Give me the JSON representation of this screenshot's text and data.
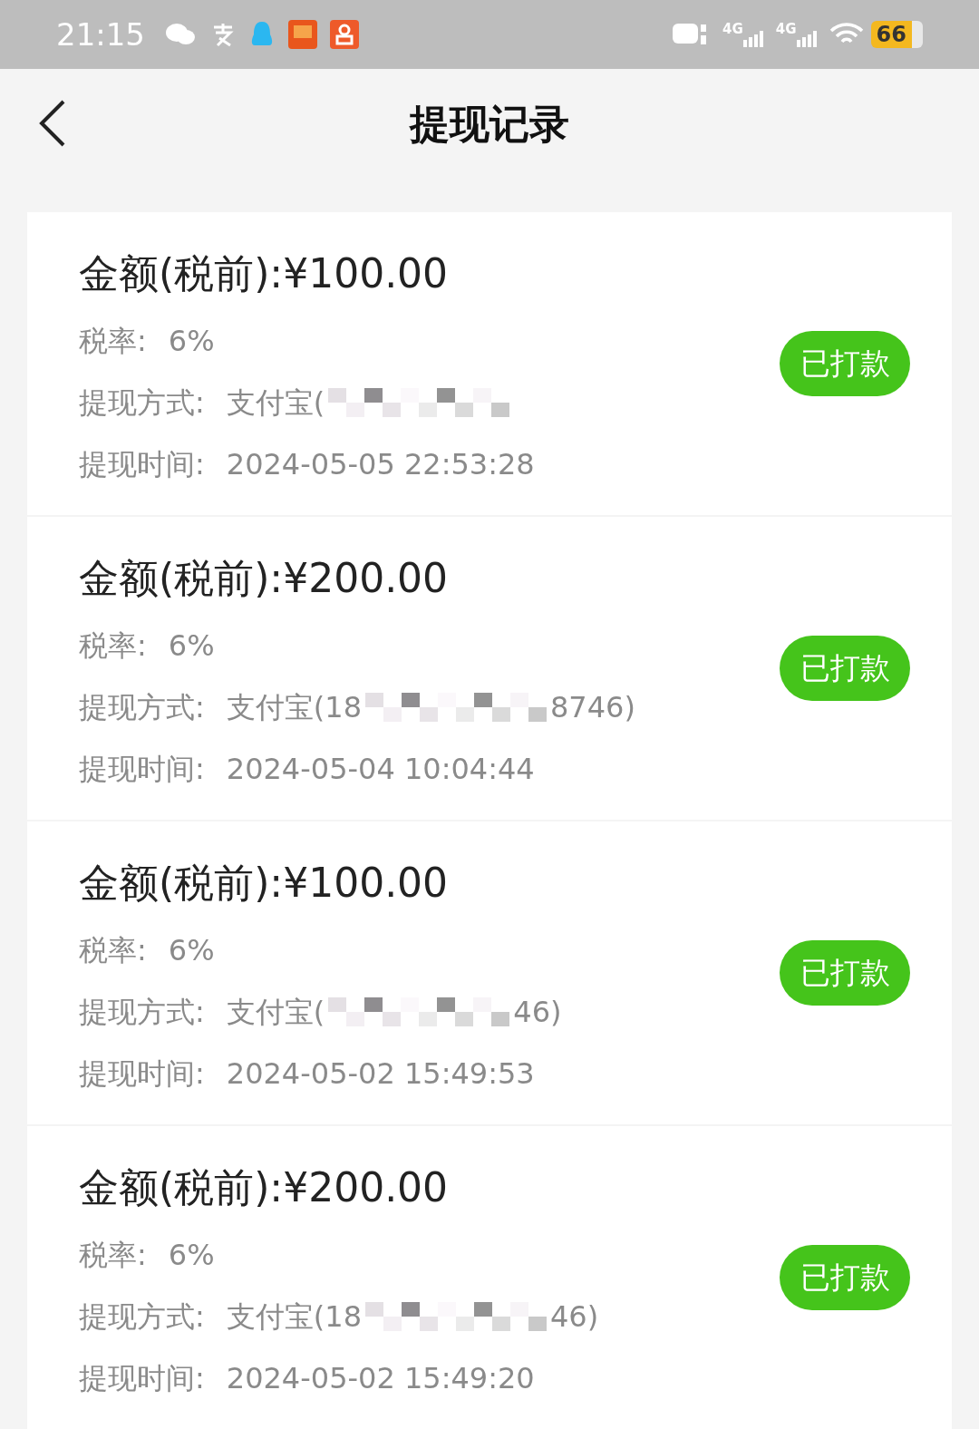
{
  "status_bar": {
    "time": "21:15",
    "network_labels": [
      "4G",
      "4G"
    ],
    "battery": "66"
  },
  "header": {
    "title": "提现记录"
  },
  "records": [
    {
      "amount_label": "金额(税前):",
      "amount": "¥100.00",
      "tax_label": "税率:",
      "tax": "6%",
      "method_label": "提现方式:",
      "method_prefix": "支付宝(",
      "time_label": "提现时间:",
      "time": "2024-05-05 22:53:28",
      "status": "已打款"
    },
    {
      "amount_label": "金额(税前):",
      "amount": "¥200.00",
      "tax_label": "税率:",
      "tax": "6%",
      "method_label": "提现方式:",
      "method_prefix": "支付宝(18",
      "method_suffix": "8746)",
      "time_label": "提现时间:",
      "time": "2024-05-04 10:04:44",
      "status": "已打款"
    },
    {
      "amount_label": "金额(税前):",
      "amount": "¥100.00",
      "tax_label": "税率:",
      "tax": "6%",
      "method_label": "提现方式:",
      "method_prefix": "支付宝(",
      "method_suffix": "46)",
      "time_label": "提现时间:",
      "time": "2024-05-02 15:49:53",
      "status": "已打款"
    },
    {
      "amount_label": "金额(税前):",
      "amount": "¥200.00",
      "tax_label": "税率:",
      "tax": "6%",
      "method_label": "提现方式:",
      "method_prefix": "支付宝(18",
      "method_suffix": "46)",
      "time_label": "提现时间:",
      "time": "2024-05-02 15:49:20",
      "status": "已打款"
    }
  ]
}
